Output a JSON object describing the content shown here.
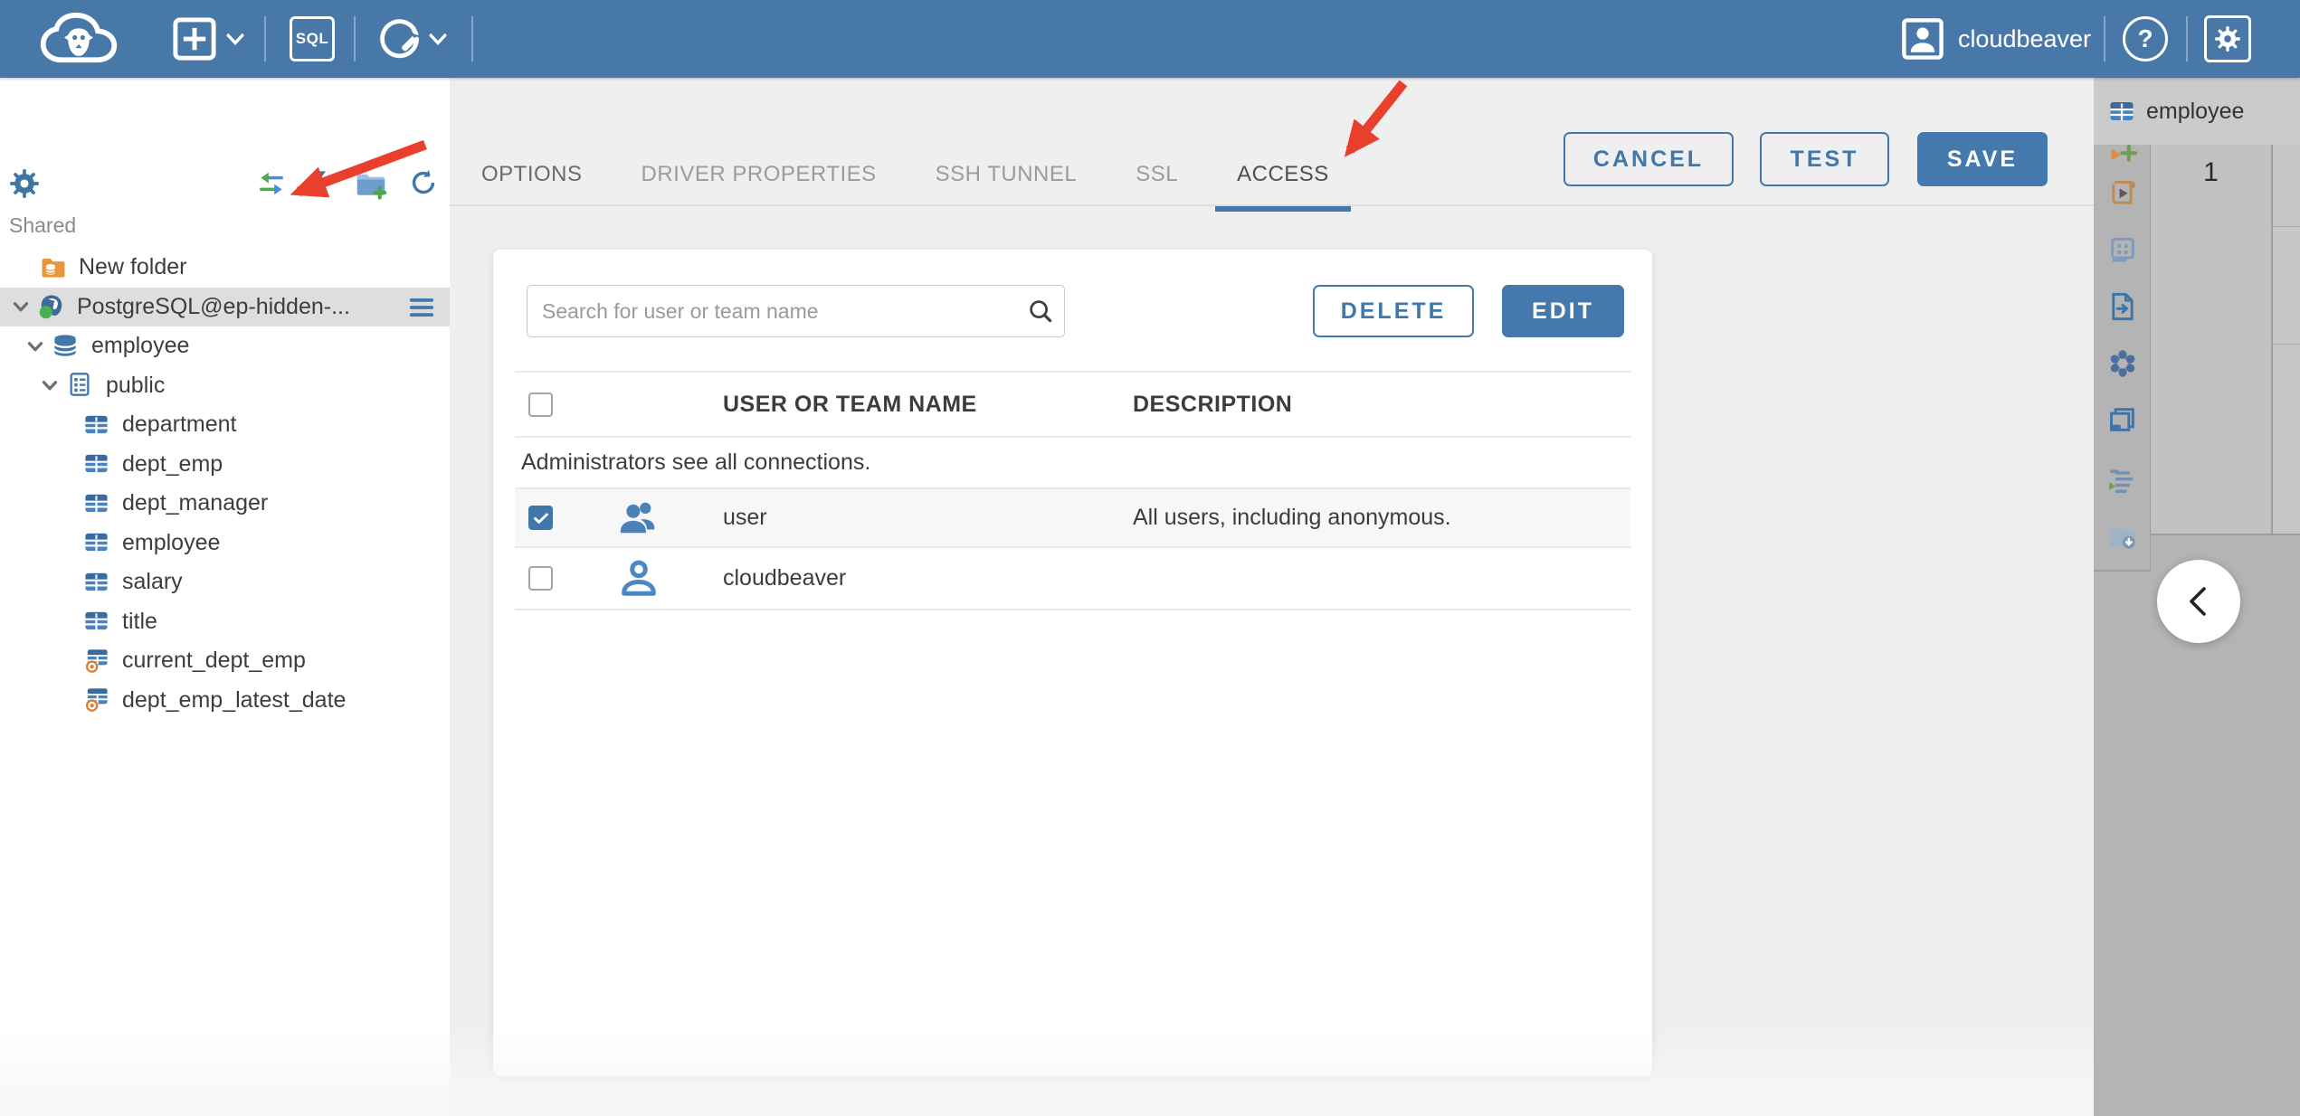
{
  "topbar": {
    "user_label": "cloudbeaver",
    "sql_badge": "SQL",
    "help_glyph": "?"
  },
  "sidebar": {
    "section_label": "Shared",
    "toolbar_icons": [
      "settings-gear-icon",
      "sync-arrows-icon",
      "collapse-all-icon",
      "add-folder-icon",
      "refresh-icon"
    ],
    "tree": [
      {
        "label": "New folder",
        "icon": "folder-database"
      },
      {
        "label": "PostgreSQL@ep-hidden-...",
        "icon": "postgresql",
        "status": "connected",
        "selected": true,
        "expanded": true
      },
      {
        "label": "employee",
        "icon": "database",
        "expanded": true
      },
      {
        "label": "public",
        "icon": "schema",
        "expanded": true
      },
      {
        "label": "department",
        "icon": "table"
      },
      {
        "label": "dept_emp",
        "icon": "table"
      },
      {
        "label": "dept_manager",
        "icon": "table"
      },
      {
        "label": "employee",
        "icon": "table"
      },
      {
        "label": "salary",
        "icon": "table"
      },
      {
        "label": "title",
        "icon": "table"
      },
      {
        "label": "current_dept_emp",
        "icon": "view"
      },
      {
        "label": "dept_emp_latest_date",
        "icon": "view"
      }
    ]
  },
  "dialog": {
    "tabs": [
      {
        "label": "OPTIONS"
      },
      {
        "label": "DRIVER PROPERTIES"
      },
      {
        "label": "SSH TUNNEL"
      },
      {
        "label": "SSL"
      },
      {
        "label": "ACCESS",
        "active": true
      }
    ],
    "buttons": {
      "cancel": "CANCEL",
      "test": "TEST",
      "save": "SAVE"
    },
    "access": {
      "search_placeholder": "Search for user or team name",
      "delete_label": "DELETE",
      "edit_label": "EDIT",
      "columns": {
        "name": "USER OR TEAM NAME",
        "description": "DESCRIPTION"
      },
      "notice": "Administrators see all connections.",
      "rows": [
        {
          "name": "user",
          "description": "All users, including anonymous.",
          "checked": true,
          "type": "team"
        },
        {
          "name": "cloudbeaver",
          "description": "",
          "checked": false,
          "type": "user"
        }
      ]
    }
  },
  "right_panel": {
    "tab_label": "employee",
    "row_number": "1",
    "toolbar_icons": [
      "add-item-icon",
      "execute-script-icon",
      "grid-view-icon",
      "export-document-icon",
      "ai-assistant-icon",
      "open-panel-icon",
      "execution-log-icon",
      "save-to-folder-icon"
    ]
  },
  "annotations": {
    "arrow_color": "#e8402c",
    "arrows": [
      "pointer-to-access-tab",
      "pointer-to-connection-node"
    ]
  },
  "colors": {
    "topbar": "#4878a8",
    "accent": "#4177ab",
    "save_button": "#4379ad",
    "status_green": "#4caf50",
    "folder_orange": "#e8973a",
    "panel_gray": "#b4b4b4"
  }
}
